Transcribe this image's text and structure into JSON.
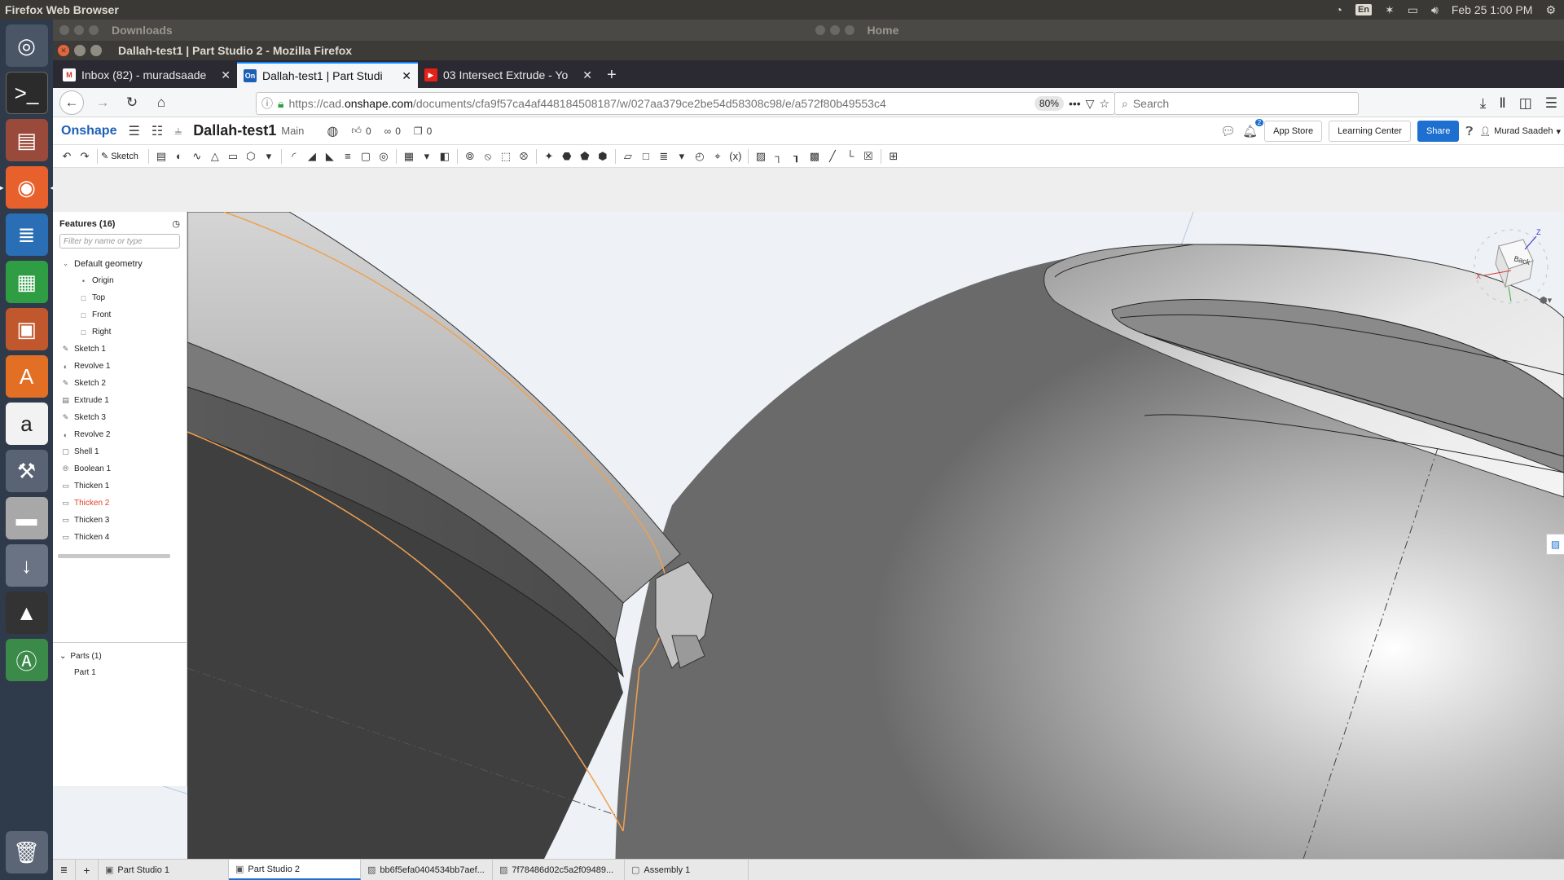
{
  "topbar": {
    "title": "Firefox Web Browser",
    "lang": "En",
    "datetime": "Feb 25  1:00 PM"
  },
  "background_windows": [
    {
      "title": "Downloads"
    },
    {
      "title": "Home"
    }
  ],
  "window": {
    "title": "Dallah-test1 | Part Studio 2 - Mozilla Firefox"
  },
  "tabs": [
    {
      "label": "Inbox (82) - muradsaade",
      "favicon": "gmail-icon"
    },
    {
      "label": "Dallah-test1 | Part Studi",
      "favicon": "onshape-icon",
      "fav_text": "On"
    },
    {
      "label": "03 Intersect Extrude - Yo",
      "favicon": "youtube-icon"
    }
  ],
  "navbar": {
    "url_prefix": "https://cad.",
    "url_domain": "onshape.com",
    "url_rest": "/documents/cfa9f57ca4af448184508187/w/027aa379ce2be54d58308c98/e/a572f80b49553c4",
    "zoom": "80%",
    "search_placeholder": "Search"
  },
  "onshape": {
    "logo": "Onshape",
    "doc_name": "Dallah-test1",
    "branch": "Main",
    "likes": "0",
    "links": "0",
    "copies": "0",
    "notifications": "2",
    "app_store": "App Store",
    "learning_center": "Learning Center",
    "share": "Share",
    "user": "Murad Saadeh"
  },
  "toolbar": {
    "sketch_label": "Sketch"
  },
  "features": {
    "header": "Features (16)",
    "filter_placeholder": "Filter by name or type",
    "items": [
      {
        "label": "Default geometry",
        "type": "group"
      },
      {
        "label": "Origin",
        "type": "child",
        "icon": "origin-icon"
      },
      {
        "label": "Top",
        "type": "child",
        "icon": "plane-icon"
      },
      {
        "label": "Front",
        "type": "child",
        "icon": "plane-icon"
      },
      {
        "label": "Right",
        "type": "child",
        "icon": "plane-icon"
      },
      {
        "label": "Sketch 1",
        "icon": "sketch-icon"
      },
      {
        "label": "Revolve 1",
        "icon": "revolve-icon"
      },
      {
        "label": "Sketch 2",
        "icon": "sketch-icon"
      },
      {
        "label": "Extrude 1",
        "icon": "extrude-icon"
      },
      {
        "label": "Sketch 3",
        "icon": "sketch-icon"
      },
      {
        "label": "Revolve 2",
        "icon": "revolve-icon"
      },
      {
        "label": "Shell 1",
        "icon": "shell-icon"
      },
      {
        "label": "Boolean 1",
        "icon": "boolean-icon"
      },
      {
        "label": "Thicken 1",
        "icon": "thicken-icon"
      },
      {
        "label": "Thicken 2",
        "icon": "thicken-icon",
        "error": true
      },
      {
        "label": "Thicken 3",
        "icon": "thicken-icon"
      },
      {
        "label": "Thicken 4",
        "icon": "thicken-icon"
      }
    ]
  },
  "parts": {
    "header": "Parts (1)",
    "items": [
      {
        "label": "Part 1"
      }
    ]
  },
  "viewcube": {
    "face": "Back",
    "axis_x": "X",
    "axis_z": "Z"
  },
  "bottom_tabs": [
    {
      "label": "Part Studio 1",
      "icon": "part-studio-icon"
    },
    {
      "label": "Part Studio 2",
      "icon": "part-studio-icon",
      "active": true
    },
    {
      "label": "bb6f5efa0404534bb7aef...",
      "icon": "image-icon"
    },
    {
      "label": "7f78486d02c5a2f09489...",
      "icon": "image-icon"
    },
    {
      "label": "Assembly 1",
      "icon": "assembly-icon"
    }
  ],
  "colors": {
    "accent": "#1d6fd0",
    "error": "#e0432b",
    "edge_highlight": "#f0a050"
  }
}
